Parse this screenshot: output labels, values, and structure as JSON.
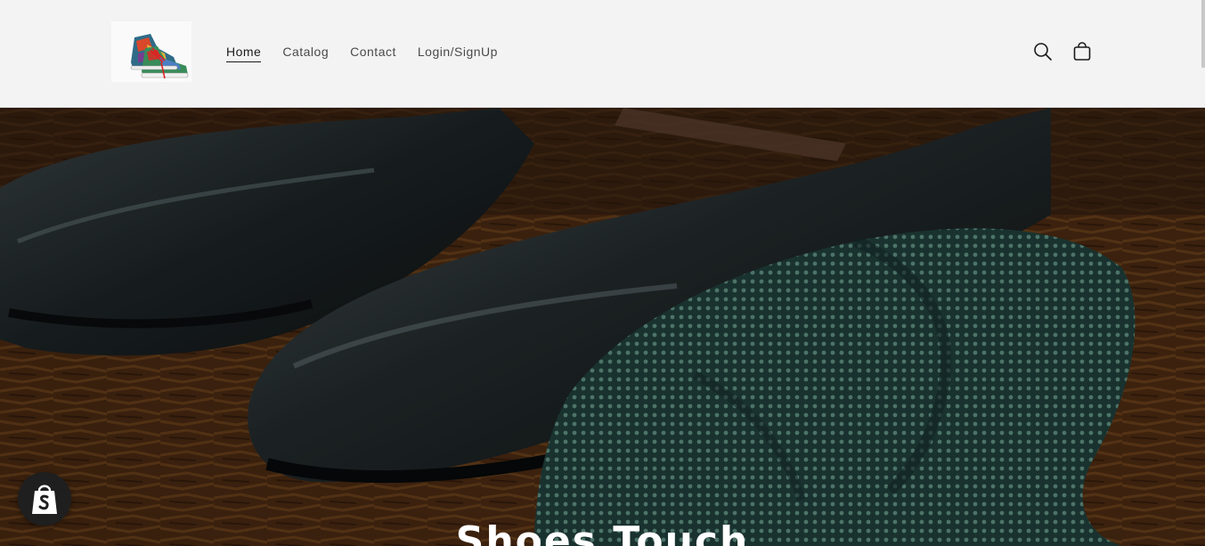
{
  "header": {
    "logo_alt": "Sneaker logo",
    "nav": [
      {
        "label": "Home",
        "active": true
      },
      {
        "label": "Catalog",
        "active": false
      },
      {
        "label": "Contact",
        "active": false
      },
      {
        "label": "Login/SignUp",
        "active": false
      }
    ],
    "icons": {
      "search": "search-icon",
      "cart": "cart-icon"
    }
  },
  "hero": {
    "title": "Shoes Touch",
    "image_alt": "Black leather shoes with a green tie on a wooden surface"
  },
  "badge": {
    "icon": "shopify-bag-icon"
  },
  "colors": {
    "header_bg": "#f3f3f3",
    "text": "#1a1a1a",
    "badge_bg": "#1f1f1f"
  }
}
